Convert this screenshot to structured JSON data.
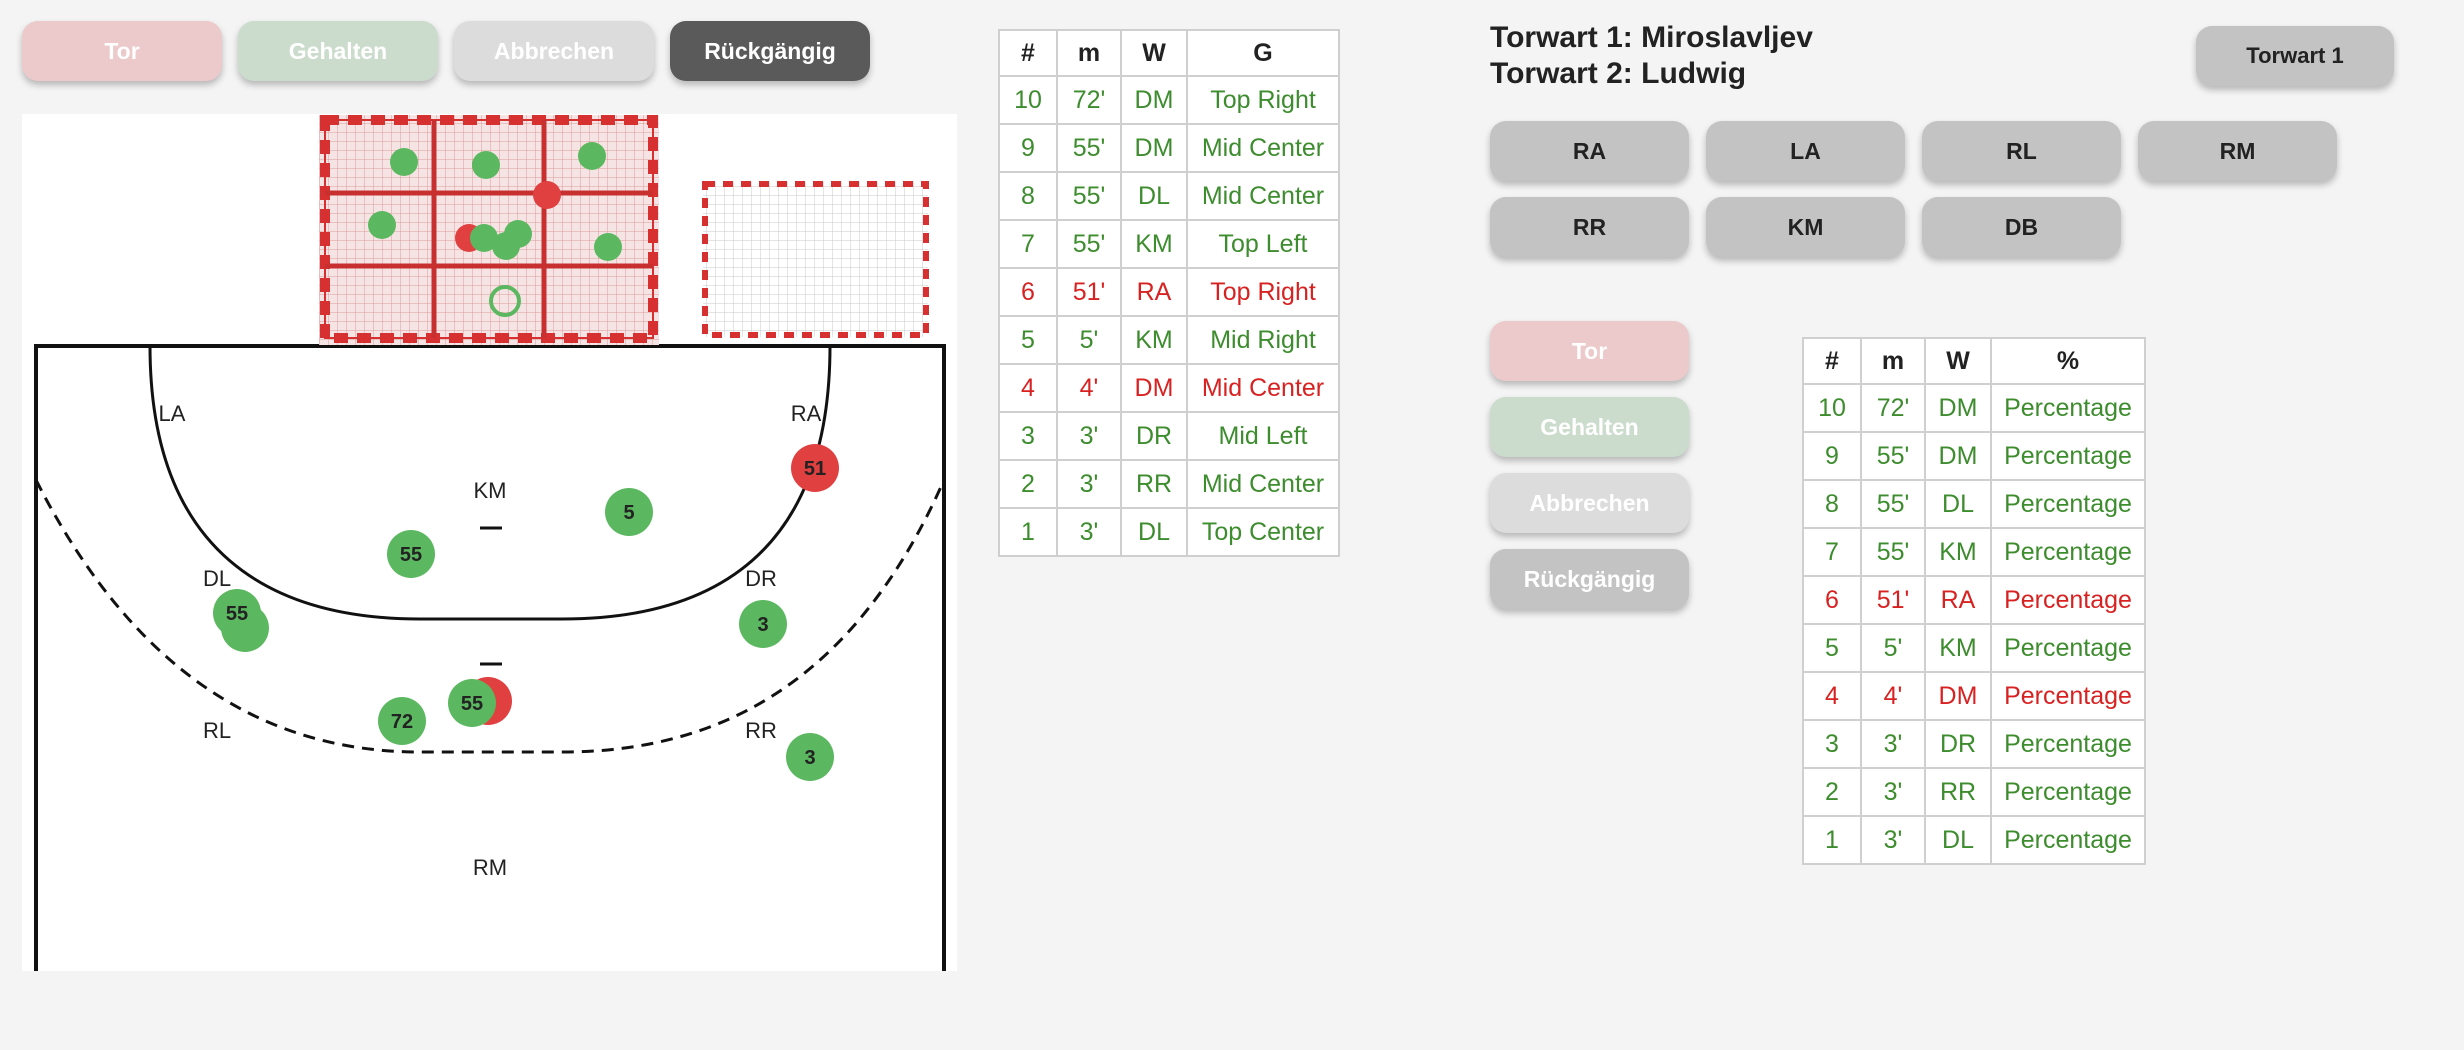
{
  "top_actions": {
    "tor": "Tor",
    "gehalten": "Gehalten",
    "abbrechen": "Abbrechen",
    "rueckgaengig": "Rückgängig"
  },
  "goalkeepers": {
    "line1": "Torwart 1: Miroslavljev",
    "line2": "Torwart 2: Ludwig",
    "toggle_button": "Torwart 1"
  },
  "position_buttons": [
    "RA",
    "LA",
    "RL",
    "RM",
    "RR",
    "KM",
    "DB"
  ],
  "secondary_actions": {
    "tor": "Tor",
    "gehalten": "Gehalten",
    "abbrechen": "Abbrechen",
    "rueckgaengig": "Rückgängig"
  },
  "court_labels": {
    "la": "LA",
    "ra": "RA",
    "km": "KM",
    "dl": "DL",
    "dr": "DR",
    "rl": "RL",
    "rr": "RR",
    "rm": "RM"
  },
  "shot_markers": [
    {
      "label": "51",
      "color": "#e04040"
    },
    {
      "label": "5",
      "color": "#5cb860"
    },
    {
      "label": "55",
      "color": "#5cb860"
    },
    {
      "label": "55",
      "color": "#5cb860"
    },
    {
      "label": "3",
      "color": "#5cb860"
    },
    {
      "label": "72",
      "color": "#5cb860"
    },
    {
      "label": "55",
      "color": "#5cb860"
    },
    {
      "label": "3",
      "color": "#5cb860"
    }
  ],
  "shots_table": {
    "headers": [
      "#",
      "m",
      "W",
      "G"
    ],
    "rows": [
      {
        "n": "10",
        "m": "72'",
        "w": "DM",
        "g": "Top Right",
        "result": "saved"
      },
      {
        "n": "9",
        "m": "55'",
        "w": "DM",
        "g": "Mid Center",
        "result": "saved"
      },
      {
        "n": "8",
        "m": "55'",
        "w": "DL",
        "g": "Mid Center",
        "result": "saved"
      },
      {
        "n": "7",
        "m": "55'",
        "w": "KM",
        "g": "Top Left",
        "result": "saved"
      },
      {
        "n": "6",
        "m": "51'",
        "w": "RA",
        "g": "Top Right",
        "result": "goal"
      },
      {
        "n": "5",
        "m": "5'",
        "w": "KM",
        "g": "Mid Right",
        "result": "saved"
      },
      {
        "n": "4",
        "m": "4'",
        "w": "DM",
        "g": "Mid Center",
        "result": "goal"
      },
      {
        "n": "3",
        "m": "3'",
        "w": "DR",
        "g": "Mid Left",
        "result": "saved"
      },
      {
        "n": "2",
        "m": "3'",
        "w": "RR",
        "g": "Mid Center",
        "result": "saved"
      },
      {
        "n": "1",
        "m": "3'",
        "w": "DL",
        "g": "Top Center",
        "result": "saved"
      }
    ]
  },
  "percent_table": {
    "headers": [
      "#",
      "m",
      "W",
      "%"
    ],
    "rows": [
      {
        "n": "10",
        "m": "72'",
        "w": "DM",
        "p": "Percentage",
        "result": "saved"
      },
      {
        "n": "9",
        "m": "55'",
        "w": "DM",
        "p": "Percentage",
        "result": "saved"
      },
      {
        "n": "8",
        "m": "55'",
        "w": "DL",
        "p": "Percentage",
        "result": "saved"
      },
      {
        "n": "7",
        "m": "55'",
        "w": "KM",
        "p": "Percentage",
        "result": "saved"
      },
      {
        "n": "6",
        "m": "51'",
        "w": "RA",
        "p": "Percentage",
        "result": "goal"
      },
      {
        "n": "5",
        "m": "5'",
        "w": "KM",
        "p": "Percentage",
        "result": "saved"
      },
      {
        "n": "4",
        "m": "4'",
        "w": "DM",
        "p": "Percentage",
        "result": "goal"
      },
      {
        "n": "3",
        "m": "3'",
        "w": "DR",
        "p": "Percentage",
        "result": "saved"
      },
      {
        "n": "2",
        "m": "3'",
        "w": "RR",
        "p": "Percentage",
        "result": "saved"
      },
      {
        "n": "1",
        "m": "3'",
        "w": "DL",
        "p": "Percentage",
        "result": "saved"
      }
    ]
  },
  "colors": {
    "saved": "#3d8c2e",
    "goal": "#d82222",
    "goal_frame": "#d63030",
    "marker_green": "#5cb860",
    "marker_red": "#e04040"
  }
}
